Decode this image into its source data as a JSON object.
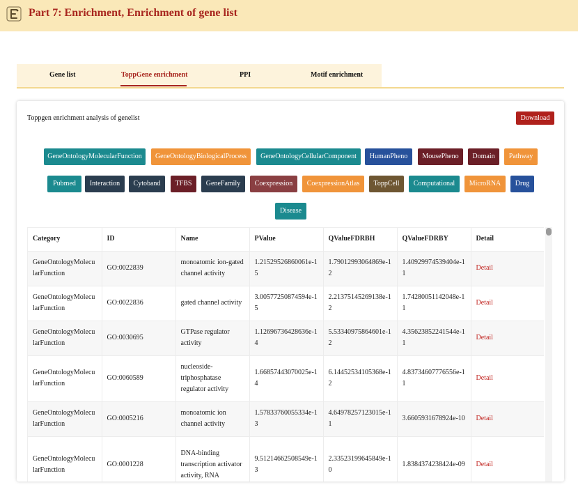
{
  "header": {
    "logo_icon": "letter-E-logo-icon",
    "title": "Part 7: Enrichment, Enrichment of gene list",
    "title_color": "#a8261f",
    "background": "#fae8b8"
  },
  "tabs": [
    {
      "label": "Gene list",
      "active": false
    },
    {
      "label": "ToppGene enrichment",
      "active": true
    },
    {
      "label": "PPI",
      "active": false
    },
    {
      "label": "Motif enrichment",
      "active": false
    }
  ],
  "card": {
    "title": "Toppgen enrichment analysis of genelist",
    "download_label": "Download",
    "download_color": "#b0211c"
  },
  "categories": [
    {
      "label": "GeneOntologyMolecularFunction",
      "color": "#1b8a8f"
    },
    {
      "label": "GeneOntologyBiologicalProcess",
      "color": "#f0943a"
    },
    {
      "label": "GeneOntologyCellularComponent",
      "color": "#1b8a8f"
    },
    {
      "label": "HumanPheno",
      "color": "#27519b"
    },
    {
      "label": "MousePheno",
      "color": "#6b1f27"
    },
    {
      "label": "Domain",
      "color": "#6b1f27"
    },
    {
      "label": "Pathway",
      "color": "#f0943a"
    },
    {
      "label": "Pubmed",
      "color": "#1b8a8f"
    },
    {
      "label": "Interaction",
      "color": "#2b3d4f"
    },
    {
      "label": "Cytoband",
      "color": "#2b3d4f"
    },
    {
      "label": "TFBS",
      "color": "#6b1f27"
    },
    {
      "label": "GeneFamily",
      "color": "#2b3d4f"
    },
    {
      "label": "Coexpression",
      "color": "#8a3f42"
    },
    {
      "label": "CoexpressionAtlas",
      "color": "#f0943a"
    },
    {
      "label": "ToppCell",
      "color": "#6e5632"
    },
    {
      "label": "Computational",
      "color": "#1b8a8f"
    },
    {
      "label": "MicroRNA",
      "color": "#f0943a"
    },
    {
      "label": "Drug",
      "color": "#27519b"
    },
    {
      "label": "Disease",
      "color": "#1b8a8f"
    }
  ],
  "table": {
    "columns": [
      "Category",
      "ID",
      "Name",
      "PValue",
      "QValueFDRBH",
      "QValueFDRBY",
      "Detail"
    ],
    "rows": [
      [
        "GeneOntologyMolecularFunction",
        "GO:0022839",
        "monoatomic ion-gated channel activity",
        "1.21529526860061e-15",
        "1.79012993064869e-12",
        "1.40929974539404e-11",
        "Detail"
      ],
      [
        "GeneOntologyMolecularFunction",
        "GO:0022836",
        "gated channel activity",
        "3.00577250874594e-15",
        "2.21375145269138e-12",
        "1.74280051142048e-11",
        "Detail"
      ],
      [
        "GeneOntologyMolecularFunction",
        "GO:0030695",
        "GTPase regulator activity",
        "1.12696736428636e-14",
        "5.53340975864601e-12",
        "4.35623852241544e-11",
        "Detail"
      ],
      [
        "GeneOntologyMolecularFunction",
        "GO:0060589",
        "nucleoside-triphosphatase regulator activity",
        "1.66857443070025e-14",
        "6.14452534105368e-12",
        "4.83734607776556e-11",
        "Detail"
      ],
      [
        "GeneOntologyMolecularFunction",
        "GO:0005216",
        "monoatomic ion channel activity",
        "1.57833760055334e-13",
        "4.64978257123015e-11",
        "3.6605931678924e-10",
        "Detail"
      ],
      [
        "GeneOntologyMolecularFunction",
        "GO:0001228",
        "DNA-binding transcription activator activity, RNA",
        "9.51214662508549e-13",
        "2.33523199645849e-10",
        "1.8384374238424e-09",
        "Detail"
      ]
    ]
  }
}
